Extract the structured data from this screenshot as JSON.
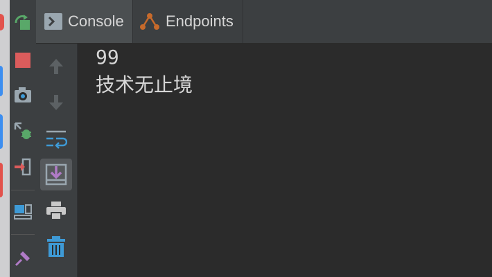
{
  "tabs": [
    {
      "label": "Console",
      "icon": "console-icon"
    },
    {
      "label": "Endpoints",
      "icon": "endpoints-icon"
    }
  ],
  "console": {
    "lines": [
      "99",
      "技术无止境"
    ]
  },
  "sidebar": {
    "buttons": [
      {
        "icon": "up-arrow-icon"
      },
      {
        "icon": "down-arrow-icon"
      },
      {
        "icon": "soft-wrap-icon"
      },
      {
        "icon": "scroll-to-end-icon",
        "active": true
      },
      {
        "icon": "print-icon"
      },
      {
        "icon": "trash-icon"
      }
    ]
  },
  "runbar": {
    "buttons": [
      "rerun-icon",
      "stop-icon",
      "camera-icon",
      "debug-export-icon",
      "exit-icon",
      "layout-icon",
      "pin-icon"
    ]
  },
  "colors": {
    "background": "#2b2b2b",
    "panel": "#3c3f41",
    "active_tab": "#4b4f51",
    "text": "#d6d6d6",
    "accent_blue": "#3e9ad6",
    "accent_orange": "#c76a2b"
  }
}
